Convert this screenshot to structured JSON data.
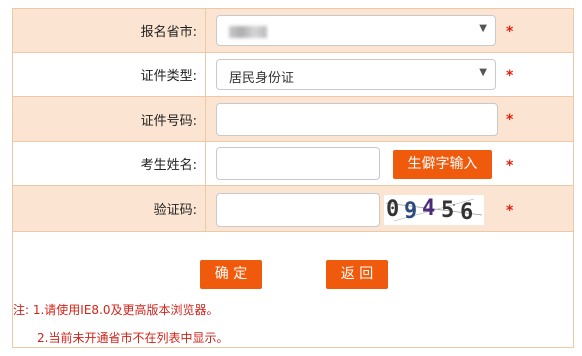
{
  "form": {
    "region": {
      "label": "报名省市:",
      "value": "",
      "required": "*"
    },
    "id_type": {
      "label": "证件类型:",
      "value": "居民身份证",
      "required": "*"
    },
    "id_number": {
      "label": "证件号码:",
      "value": "",
      "required": "*"
    },
    "name": {
      "label": "考生姓名:",
      "value": "",
      "required": "*",
      "rare_char_button": "生僻字输入"
    },
    "captcha": {
      "label": "验证码:",
      "value": "",
      "required": "*",
      "code": [
        "0",
        "9",
        "4",
        "5",
        "6"
      ]
    }
  },
  "actions": {
    "confirm": "确 定",
    "back": "返 回"
  },
  "notes": {
    "line1": "注: 1.请使用IE8.0及更高版本浏览器。",
    "line2": "2.当前未开通省市不在列表中显示。"
  },
  "colors": {
    "accent": "#f05a0c",
    "row_shade": "#fbe5d2",
    "border": "#ecc9a8",
    "required": "#e02010"
  }
}
